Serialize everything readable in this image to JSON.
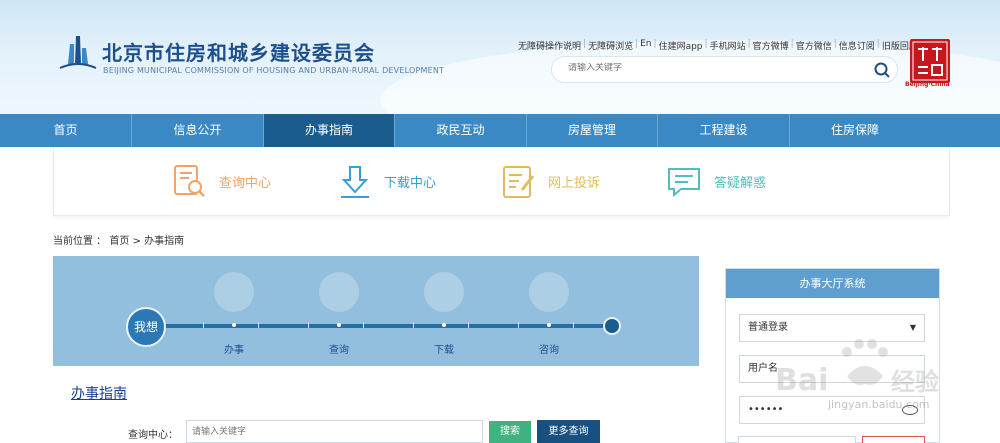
{
  "header": {
    "title": "北京市住房和城乡建设委员会",
    "subtitle": "BEIJING MUNICIPAL COMMISSION OF HOUSING AND URBAN-RURAL DEVELOPMENT",
    "top_links": [
      "无障碍操作说明",
      "无障碍浏览",
      "En",
      "住建网app",
      "手机网站",
      "官方微博",
      "官方微信",
      "信息订阅",
      "旧版回顾"
    ],
    "search_placeholder": "请输入关键字",
    "seal_caption": "Beijing·China"
  },
  "nav": {
    "items": [
      "首页",
      "信息公开",
      "办事指南",
      "政民互动",
      "房屋管理",
      "工程建设",
      "住房保障"
    ],
    "active": "办事指南"
  },
  "quick_links": [
    {
      "label": "查询中心",
      "icon": "query-doc-icon",
      "color": "#f0a46b"
    },
    {
      "label": "下载中心",
      "icon": "download-icon",
      "color": "#3b9dd8"
    },
    {
      "label": "网上投诉",
      "icon": "complaint-icon",
      "color": "#e2bb5d"
    },
    {
      "label": "答疑解惑",
      "icon": "chat-icon",
      "color": "#4fbfb8"
    }
  ],
  "breadcrumb": {
    "prefix": "当前位置 ：",
    "home": "首页",
    "separator": ">",
    "current": "办事指南"
  },
  "banner": {
    "start_label": "我想",
    "steps": [
      "办事",
      "查询",
      "下载",
      "咨询"
    ]
  },
  "guide": {
    "title": "办事指南",
    "query_label": "查询中心：",
    "query_placeholder": "请输入关键字",
    "search_button": "搜索",
    "more_button": "更多查询"
  },
  "side_panel": {
    "title": "办事大厅系统",
    "login_type": "普通登录",
    "username_label": "用户名",
    "password_mask": "••••••"
  },
  "watermark": {
    "text": "jingyan.baidu.com"
  },
  "colors": {
    "nav_bg": "#3a89c4",
    "nav_active": "#1b5c8e",
    "banner_bg": "#92bfde",
    "search_button": "#3fb27f",
    "more_button": "#18507f",
    "panel_header": "#5f9fd0",
    "link": "#1a3e9c"
  }
}
